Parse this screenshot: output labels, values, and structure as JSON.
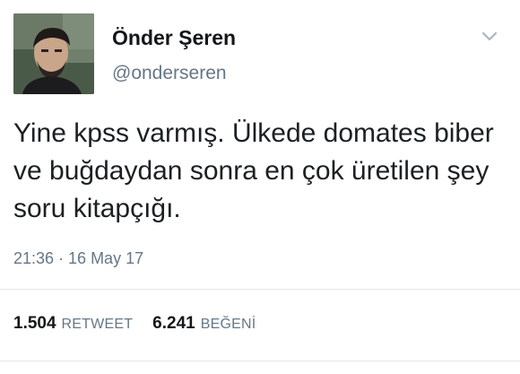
{
  "user": {
    "display_name": "Önder Şeren",
    "username": "@onderseren",
    "avatar": "profile-photo"
  },
  "tweet": {
    "text": "Yine kpss varmış. Ülkede domates biber ve buğdaydan sonra en çok üretilen şey soru kitapçığı.",
    "timestamp": "21:36 · 16 May 17"
  },
  "stats": {
    "retweets_count": "1.504",
    "retweets_label": "RETWEET",
    "likes_count": "6.241",
    "likes_label": "BEĞENİ"
  },
  "icons": {
    "menu": "chevron-down-icon"
  },
  "colors": {
    "secondary_text": "#657786",
    "divider": "#e1e8ed"
  }
}
